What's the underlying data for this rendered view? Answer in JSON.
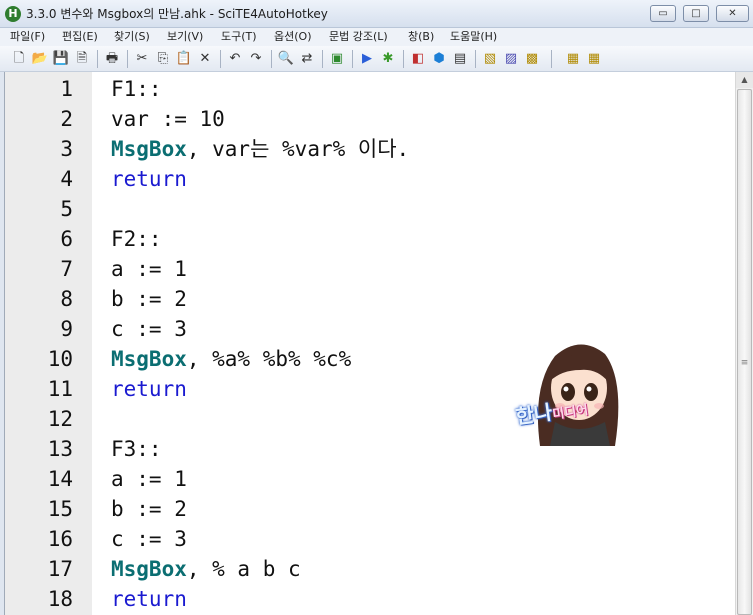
{
  "window": {
    "title": "3.3.0 변수와 Msgbox의 만남.ahk - SciTE4AutoHotkey",
    "app_icon_letter": "H",
    "minimize_glyph": "▭",
    "maximize_glyph": "□",
    "close_glyph": "✕"
  },
  "menu": [
    "파일(F)",
    "편집(E)",
    "찾기(S)",
    "보기(V)",
    "도구(T)",
    "옵션(O)",
    "문법 강조(L)",
    "창(B)",
    "도움말(H)"
  ],
  "toolbar": {
    "buttons": [
      {
        "name": "new-file-icon",
        "glyph": "🗋"
      },
      {
        "name": "open-folder-icon",
        "glyph": "📂"
      },
      {
        "name": "save-icon",
        "glyph": "💾"
      },
      {
        "name": "save-as-icon",
        "glyph": "🗎"
      },
      {
        "name": "print-icon",
        "glyph": "🖶"
      },
      {
        "name": "cut-icon",
        "glyph": "✂"
      },
      {
        "name": "copy-icon",
        "glyph": "⎘"
      },
      {
        "name": "paste-icon",
        "glyph": "📋"
      },
      {
        "name": "delete-icon",
        "glyph": "✕"
      },
      {
        "name": "undo-icon",
        "glyph": "↶"
      },
      {
        "name": "redo-icon",
        "glyph": "↷"
      },
      {
        "name": "find-icon",
        "glyph": "🔍"
      },
      {
        "name": "replace-icon",
        "glyph": "⇄"
      },
      {
        "name": "compile-icon",
        "glyph": "▣"
      },
      {
        "name": "run-icon",
        "glyph": "▶"
      },
      {
        "name": "debug-icon",
        "glyph": "✱"
      },
      {
        "name": "window-spy-icon",
        "glyph": "◧"
      },
      {
        "name": "cube-icon",
        "glyph": "⬢"
      },
      {
        "name": "console-icon",
        "glyph": "▤"
      },
      {
        "name": "script-icon",
        "glyph": "▧"
      },
      {
        "name": "script-edit-icon",
        "glyph": "▨"
      },
      {
        "name": "script-list-icon",
        "glyph": "▩"
      },
      {
        "name": "tool-a-icon",
        "glyph": "▦"
      },
      {
        "name": "tool-b-icon",
        "glyph": "▦"
      }
    ],
    "colors": {
      "run": "#2b5fd8",
      "debug": "#3a9a2a",
      "compile": "#2e8a2e",
      "find": "#333333"
    }
  },
  "editor": {
    "lines": [
      {
        "num": "1",
        "tokens": [
          {
            "t": "F1::",
            "c": "plain"
          }
        ]
      },
      {
        "num": "2",
        "tokens": [
          {
            "t": "var := 10",
            "c": "plain"
          }
        ]
      },
      {
        "num": "3",
        "tokens": [
          {
            "t": "MsgBox",
            "c": "cmd"
          },
          {
            "t": ", var는 %var% 이다.",
            "c": "plain"
          }
        ]
      },
      {
        "num": "4",
        "tokens": [
          {
            "t": "return",
            "c": "ret"
          }
        ]
      },
      {
        "num": "5",
        "tokens": []
      },
      {
        "num": "6",
        "tokens": [
          {
            "t": "F2::",
            "c": "plain"
          }
        ]
      },
      {
        "num": "7",
        "tokens": [
          {
            "t": "a := 1",
            "c": "plain"
          }
        ]
      },
      {
        "num": "8",
        "tokens": [
          {
            "t": "b := 2",
            "c": "plain"
          }
        ]
      },
      {
        "num": "9",
        "tokens": [
          {
            "t": "c := 3",
            "c": "plain"
          }
        ]
      },
      {
        "num": "10",
        "tokens": [
          {
            "t": "MsgBox",
            "c": "cmd"
          },
          {
            "t": ", %a% %b% %c%",
            "c": "plain"
          }
        ]
      },
      {
        "num": "11",
        "tokens": [
          {
            "t": "return",
            "c": "ret"
          }
        ]
      },
      {
        "num": "12",
        "tokens": []
      },
      {
        "num": "13",
        "tokens": [
          {
            "t": "F3::",
            "c": "plain"
          }
        ]
      },
      {
        "num": "14",
        "tokens": [
          {
            "t": "a := 1",
            "c": "plain"
          }
        ]
      },
      {
        "num": "15",
        "tokens": [
          {
            "t": "b := 2",
            "c": "plain"
          }
        ]
      },
      {
        "num": "16",
        "tokens": [
          {
            "t": "c := 3",
            "c": "plain"
          }
        ]
      },
      {
        "num": "17",
        "tokens": [
          {
            "t": "MsgBox",
            "c": "cmd"
          },
          {
            "t": ", % a b c",
            "c": "plain"
          }
        ]
      },
      {
        "num": "18",
        "tokens": [
          {
            "t": "return",
            "c": "ret"
          }
        ]
      }
    ],
    "syntax_colors": {
      "cmd": "#0b6e72",
      "ret": "#1a1ad0",
      "plain": "#111111"
    }
  },
  "scrollbar": {
    "up_glyph": "▲",
    "grip_glyph": "≡"
  },
  "watermark": {
    "main_text": "한나",
    "small_text": "미디어"
  }
}
